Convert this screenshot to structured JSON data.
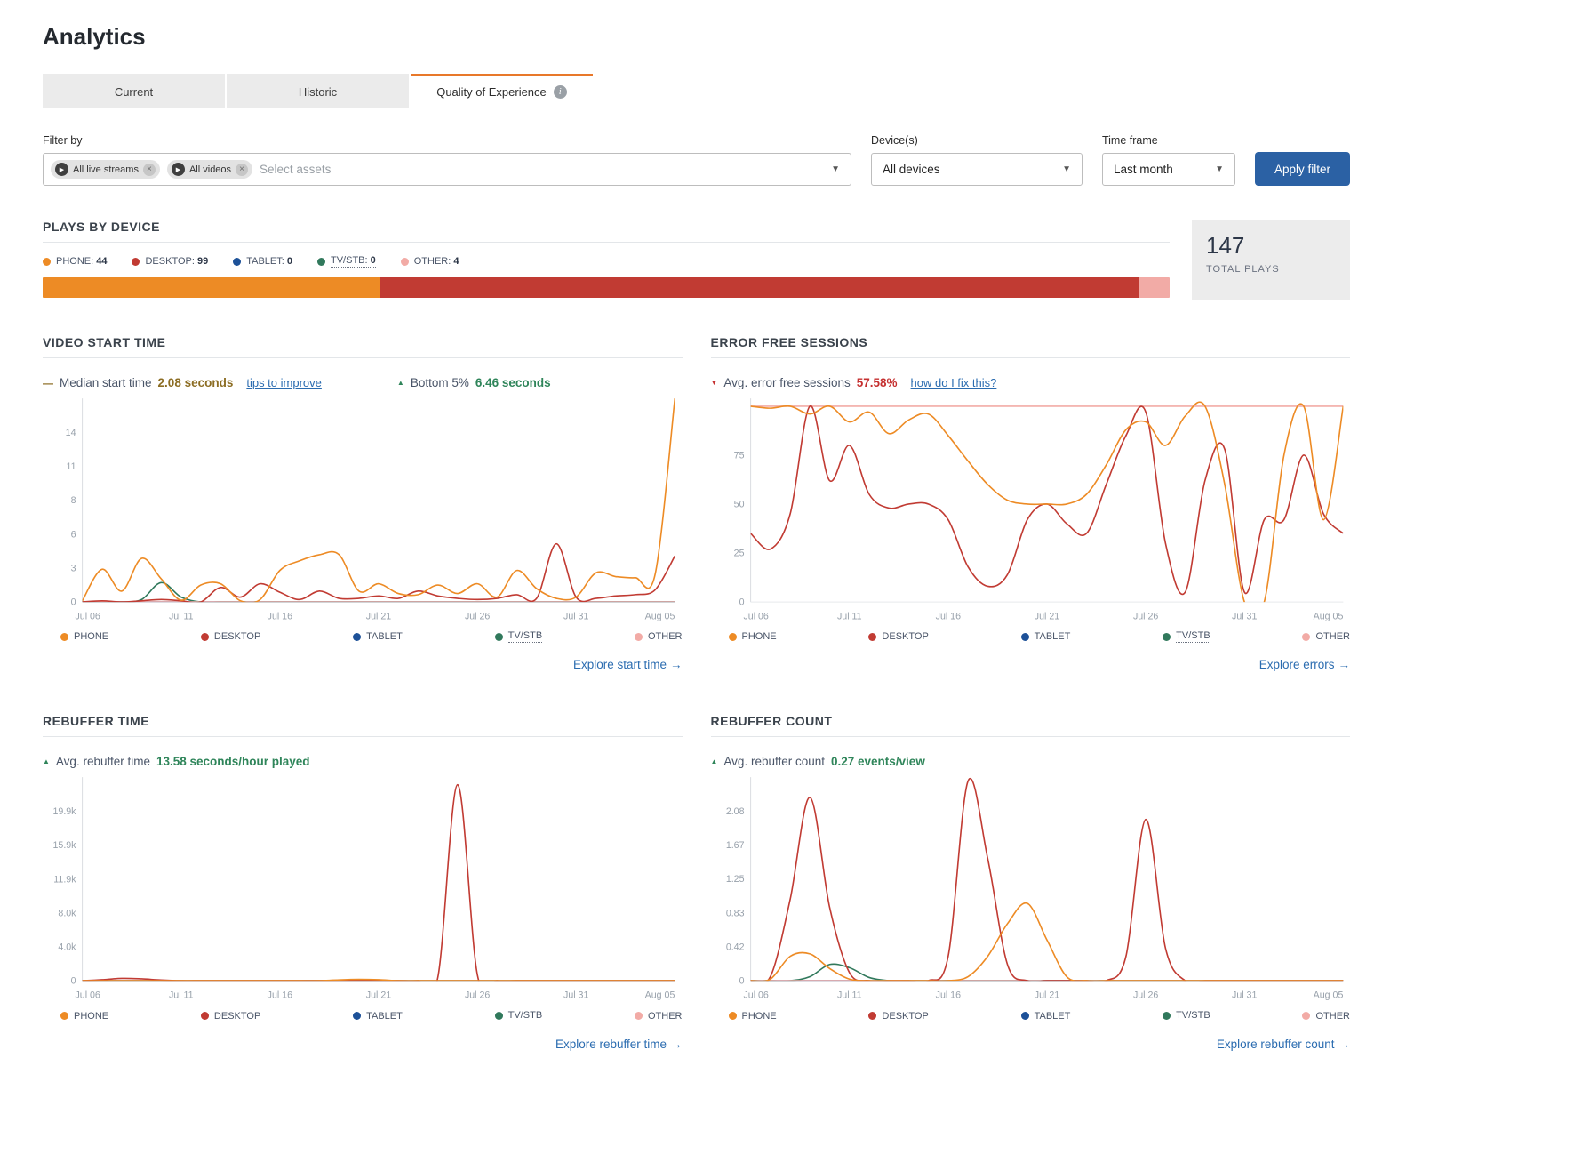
{
  "colors": {
    "phone": "#ED8B25",
    "desktop": "#C13B33",
    "tablet": "#1D5198",
    "tvstb": "#31795C",
    "other": "#F2ABA6",
    "link": "#2B6CB0",
    "button": "#2B61A4",
    "accent_tab": "#E8782A"
  },
  "page": {
    "title": "Analytics"
  },
  "tabs": [
    {
      "label": "Current",
      "active": false
    },
    {
      "label": "Historic",
      "active": false
    },
    {
      "label": "Quality of Experience",
      "active": true
    }
  ],
  "filters": {
    "filter_by_label": "Filter by",
    "chips": [
      {
        "label": "All live streams"
      },
      {
        "label": "All videos"
      }
    ],
    "assets_placeholder": "Select assets",
    "devices_label": "Device(s)",
    "devices_value": "All devices",
    "timeframe_label": "Time frame",
    "timeframe_value": "Last month",
    "apply_label": "Apply filter"
  },
  "plays_by_device": {
    "heading": "PLAYS BY DEVICE",
    "total_value": "147",
    "total_label": "TOTAL PLAYS",
    "legend": [
      {
        "label": "PHONE",
        "value": "44",
        "color_key": "phone"
      },
      {
        "label": "DESKTOP",
        "value": "99",
        "color_key": "desktop"
      },
      {
        "label": "TABLET",
        "value": "0",
        "color_key": "tablet"
      },
      {
        "label": "TV/STB",
        "value": "0",
        "color_key": "tvstb",
        "underline": true
      },
      {
        "label": "OTHER",
        "value": "4",
        "color_key": "other"
      }
    ],
    "bar": [
      {
        "color_key": "phone",
        "pct": 29.9
      },
      {
        "color_key": "desktop",
        "pct": 67.4
      },
      {
        "color_key": "other",
        "pct": 2.7
      }
    ]
  },
  "series_legend": [
    {
      "label": "PHONE",
      "color_key": "phone"
    },
    {
      "label": "DESKTOP",
      "color_key": "desktop"
    },
    {
      "label": "TABLET",
      "color_key": "tablet"
    },
    {
      "label": "TV/STB",
      "color_key": "tvstb",
      "underline": true
    },
    {
      "label": "OTHER",
      "color_key": "other"
    }
  ],
  "panels": {
    "video_start_time": {
      "heading": "VIDEO START TIME",
      "stat1_label": "Median start time",
      "stat1_value": "2.08 seconds",
      "stat1_link": "tips to improve",
      "stat2_label": "Bottom 5%",
      "stat2_value": "6.46 seconds",
      "explore": "Explore start time"
    },
    "error_free_sessions": {
      "heading": "ERROR FREE SESSIONS",
      "stat1_label": "Avg. error free sessions",
      "stat1_value": "57.58%",
      "stat1_link": "how do I fix this?",
      "explore": "Explore errors"
    },
    "rebuffer_time": {
      "heading": "REBUFFER TIME",
      "stat1_label": "Avg. rebuffer time",
      "stat1_value": "13.58 seconds/hour played",
      "explore": "Explore rebuffer time"
    },
    "rebuffer_count": {
      "heading": "REBUFFER COUNT",
      "stat1_label": "Avg. rebuffer count",
      "stat1_value": "0.27 events/view",
      "explore": "Explore rebuffer count"
    }
  },
  "chart_data": [
    {
      "id": "video_start_time",
      "type": "line",
      "title": "Video start time (seconds), daily Jul 06 - Aug 05",
      "ymax": 16.8,
      "yticks": [
        {
          "v": 0,
          "label": "0"
        },
        {
          "v": 2.8,
          "label": "3"
        },
        {
          "v": 5.6,
          "label": "6"
        },
        {
          "v": 8.4,
          "label": "8"
        },
        {
          "v": 11.2,
          "label": "11"
        },
        {
          "v": 14,
          "label": "14"
        }
      ],
      "x_labels": [
        "Jul 06",
        "Jul 11",
        "Jul 16",
        "Jul 21",
        "Jul 26",
        "Jul 31",
        "Aug 05"
      ],
      "xtick_every": 5,
      "series": [
        {
          "name": "TABLET",
          "color_key": "tablet",
          "values": [
            0,
            0,
            0,
            0,
            0,
            0,
            0,
            0,
            0,
            0,
            0,
            0,
            0,
            0,
            0,
            0,
            0,
            0,
            0,
            0,
            0,
            0,
            0,
            0,
            0,
            0,
            0,
            0,
            0,
            0,
            0
          ]
        },
        {
          "name": "TV/STB",
          "color_key": "tvstb",
          "values": [
            0,
            0,
            0,
            0.2,
            1.6,
            0.4,
            0,
            0,
            0,
            0,
            0,
            0,
            0,
            0,
            0,
            0,
            0,
            0,
            0,
            0,
            0,
            0,
            0,
            0,
            0,
            0,
            0,
            0,
            0,
            0,
            0
          ]
        },
        {
          "name": "OTHER",
          "color_key": "other",
          "values": [
            0,
            0,
            0,
            0,
            0,
            0,
            0,
            0,
            0,
            0,
            0,
            0,
            0,
            0,
            0,
            0,
            0,
            0,
            0,
            0,
            0,
            0,
            0,
            0,
            0,
            0,
            0,
            0,
            0,
            0,
            0
          ]
        },
        {
          "name": "DESKTOP",
          "color_key": "desktop",
          "values": [
            0,
            0.1,
            0,
            0.1,
            0.2,
            0.1,
            0,
            1.2,
            0.4,
            1.5,
            0.8,
            0.2,
            0.9,
            0.3,
            0.3,
            0.5,
            0.3,
            0.9,
            0.5,
            0.3,
            0.2,
            0.3,
            0.6,
            0.3,
            4.8,
            0.4,
            0.3,
            0.5,
            0.6,
            1.0,
            3.8
          ]
        },
        {
          "name": "PHONE",
          "color_key": "phone",
          "values": [
            0.1,
            2.7,
            0.9,
            3.6,
            1.9,
            0.15,
            1.4,
            1.5,
            0.1,
            0.2,
            2.6,
            3.4,
            3.9,
            3.9,
            0.9,
            1.5,
            0.7,
            0.6,
            1.4,
            0.7,
            1.5,
            0.4,
            2.6,
            1.1,
            0.3,
            0.4,
            2.4,
            2.1,
            2.0,
            2.3,
            16.8
          ]
        }
      ]
    },
    {
      "id": "error_free_sessions",
      "type": "line",
      "title": "Error free sessions (%), daily Jul 06 - Aug 05",
      "ymax": 104,
      "yticks": [
        {
          "v": 0,
          "label": "0"
        },
        {
          "v": 25,
          "label": "25"
        },
        {
          "v": 50,
          "label": "50"
        },
        {
          "v": 75,
          "label": "75"
        }
      ],
      "x_labels": [
        "Jul 06",
        "Jul 11",
        "Jul 16",
        "Jul 21",
        "Jul 26",
        "Jul 31",
        "Aug 05"
      ],
      "xtick_every": 5,
      "series": [
        {
          "name": "TABLET",
          "color_key": "tablet",
          "values": []
        },
        {
          "name": "TV/STB",
          "color_key": "tvstb",
          "values": []
        },
        {
          "name": "OTHER",
          "color_key": "other",
          "values": [
            100,
            100,
            100,
            100,
            100,
            100,
            100,
            100,
            100,
            100,
            100,
            100,
            100,
            100,
            100,
            100,
            100,
            100,
            100,
            100,
            100,
            100,
            100,
            100,
            100,
            100,
            100,
            100,
            100,
            100,
            100
          ]
        },
        {
          "name": "DESKTOP",
          "color_key": "desktop",
          "values": [
            35,
            27,
            45,
            100,
            62,
            80,
            55,
            48,
            50,
            50,
            42,
            18,
            8,
            14,
            42,
            50,
            40,
            35,
            60,
            85,
            97,
            30,
            5,
            62,
            78,
            5,
            42,
            42,
            75,
            45,
            35
          ]
        },
        {
          "name": "PHONE",
          "color_key": "phone",
          "values": [
            100,
            99,
            100,
            96,
            100,
            92,
            97,
            86,
            93,
            96,
            85,
            72,
            60,
            52,
            50,
            50,
            50,
            55,
            70,
            88,
            92,
            80,
            95,
            100,
            60,
            0,
            0,
            75,
            100,
            42,
            100
          ]
        }
      ]
    },
    {
      "id": "rebuffer_time",
      "type": "line",
      "title": "Rebuffer time (seconds/hour), daily Jul 06 - Aug 05",
      "ymax": 23900,
      "yticks": [
        {
          "v": 0,
          "label": "0"
        },
        {
          "v": 3975,
          "label": "4.0k"
        },
        {
          "v": 7950,
          "label": "8.0k"
        },
        {
          "v": 11925,
          "label": "11.9k"
        },
        {
          "v": 15900,
          "label": "15.9k"
        },
        {
          "v": 19875,
          "label": "19.9k"
        }
      ],
      "x_labels": [
        "Jul 06",
        "Jul 11",
        "Jul 16",
        "Jul 21",
        "Jul 26",
        "Jul 31",
        "Aug 05"
      ],
      "xtick_every": 5,
      "series": [
        {
          "name": "TABLET",
          "color_key": "tablet",
          "values": [
            0,
            0,
            0,
            0,
            0,
            0,
            0,
            0,
            0,
            0,
            0,
            0,
            0,
            0,
            0,
            0,
            0,
            0,
            0,
            0,
            0,
            0,
            0,
            0,
            0,
            0,
            0,
            0,
            0,
            0,
            0
          ]
        },
        {
          "name": "TV/STB",
          "color_key": "tvstb",
          "values": [
            0,
            0,
            0,
            0,
            0,
            0,
            0,
            0,
            0,
            0,
            0,
            0,
            0,
            0,
            0,
            0,
            0,
            0,
            0,
            0,
            0,
            0,
            0,
            0,
            0,
            0,
            0,
            0,
            0,
            0,
            0
          ]
        },
        {
          "name": "OTHER",
          "color_key": "other",
          "values": [
            0,
            0,
            0,
            0,
            0,
            0,
            0,
            0,
            0,
            0,
            0,
            0,
            0,
            0,
            0,
            0,
            0,
            0,
            0,
            0,
            0,
            0,
            0,
            0,
            0,
            0,
            0,
            0,
            0,
            0,
            0
          ]
        },
        {
          "name": "DESKTOP",
          "color_key": "desktop",
          "values": [
            0,
            120,
            280,
            220,
            80,
            0,
            0,
            0,
            0,
            0,
            0,
            0,
            0,
            0,
            0,
            0,
            0,
            0,
            400,
            23000,
            700,
            0,
            0,
            0,
            0,
            0,
            0,
            0,
            0,
            0,
            0
          ]
        },
        {
          "name": "PHONE",
          "color_key": "phone",
          "values": [
            0,
            0,
            0,
            0,
            0,
            0,
            0,
            0,
            0,
            0,
            0,
            0,
            0,
            100,
            160,
            120,
            0,
            0,
            0,
            0,
            0,
            0,
            0,
            0,
            0,
            0,
            0,
            0,
            0,
            0,
            0
          ]
        }
      ]
    },
    {
      "id": "rebuffer_count",
      "type": "line",
      "title": "Rebuffer count (events/view), daily Jul 06 - Aug 05",
      "ymax": 2.5,
      "yticks": [
        {
          "v": 0,
          "label": "0"
        },
        {
          "v": 0.4167,
          "label": "0.42"
        },
        {
          "v": 0.8333,
          "label": "0.83"
        },
        {
          "v": 1.25,
          "label": "1.25"
        },
        {
          "v": 1.6667,
          "label": "1.67"
        },
        {
          "v": 2.0833,
          "label": "2.08"
        }
      ],
      "x_labels": [
        "Jul 06",
        "Jul 11",
        "Jul 16",
        "Jul 21",
        "Jul 26",
        "Jul 31",
        "Aug 05"
      ],
      "xtick_every": 5,
      "series": [
        {
          "name": "TABLET",
          "color_key": "tablet",
          "values": [
            0,
            0,
            0,
            0,
            0,
            0,
            0,
            0,
            0,
            0,
            0,
            0,
            0,
            0,
            0,
            0,
            0,
            0,
            0,
            0,
            0,
            0,
            0,
            0,
            0,
            0,
            0,
            0,
            0,
            0,
            0
          ]
        },
        {
          "name": "TV/STB",
          "color_key": "tvstb",
          "values": [
            0,
            0,
            0,
            0.05,
            0.2,
            0.16,
            0.04,
            0,
            0,
            0,
            0,
            0,
            0,
            0,
            0,
            0,
            0,
            0,
            0,
            0,
            0,
            0,
            0,
            0,
            0,
            0,
            0,
            0,
            0,
            0,
            0
          ]
        },
        {
          "name": "OTHER",
          "color_key": "other",
          "values": [
            0,
            0,
            0,
            0,
            0,
            0,
            0,
            0,
            0,
            0,
            0,
            0,
            0,
            0,
            0,
            0,
            0,
            0,
            0,
            0,
            0,
            0,
            0,
            0,
            0,
            0,
            0,
            0,
            0,
            0,
            0
          ]
        },
        {
          "name": "DESKTOP",
          "color_key": "desktop",
          "values": [
            0,
            0.05,
            1.0,
            2.25,
            0.9,
            0.1,
            0,
            0,
            0,
            0,
            0.3,
            2.45,
            1.5,
            0.2,
            0,
            0,
            0,
            0,
            0,
            0.3,
            1.98,
            0.4,
            0,
            0,
            0,
            0,
            0,
            0,
            0,
            0,
            0
          ]
        },
        {
          "name": "PHONE",
          "color_key": "phone",
          "values": [
            0,
            0.02,
            0.3,
            0.33,
            0.15,
            0.02,
            0,
            0,
            0,
            0,
            0,
            0.05,
            0.3,
            0.7,
            0.95,
            0.5,
            0.05,
            0,
            0,
            0,
            0,
            0,
            0,
            0,
            0,
            0,
            0,
            0,
            0,
            0,
            0
          ]
        }
      ]
    }
  ]
}
